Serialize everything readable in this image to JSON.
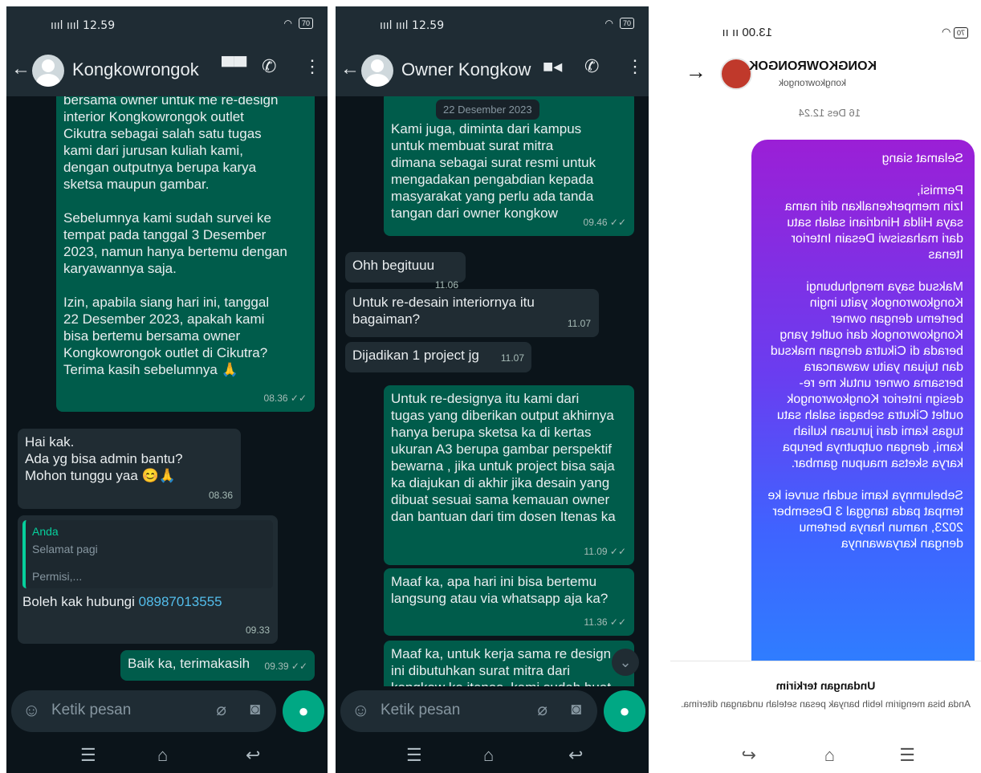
{
  "panel1": {
    "status_time": "12.59",
    "battery": "70",
    "chat_name": "Kongkowrongok",
    "messages": {
      "m1_text": "bersama owner untuk me re-design\ninterior Kongkowrongok outlet\nCikutra sebagai salah satu tugas\nkami dari jurusan kuliah kami,\ndengan outputnya berupa karya\nsketsa maupun gambar.\n\nSebelumnya kami sudah survei ke\ntempat pada tanggal 3 Desember\n2023, namun hanya bertemu dengan\nkaryawannya saja.\n\nIzin, apabila siang hari ini, tanggal\n22 Desember 2023, apakah kami\nbisa bertemu bersama owner\nKongkowrongok outlet di Cikutra?\nTerima kasih sebelumnya 🙏",
      "m1_time": "08.36",
      "m2_text": "Hai kak.\nAda yg bisa admin bantu?\nMohon tunggu yaa 😊🙏",
      "m2_time": "08.36",
      "m3_reply_sender": "Anda",
      "m3_reply_line1": "Selamat pagi",
      "m3_reply_line2": "Permisi,...",
      "m3_text": "Boleh kak hubungi ",
      "m3_phone": "08987013555",
      "m3_time": "09.33",
      "m4_text": "Baik ka, terimakasih",
      "m4_time": "09.39"
    },
    "composer_placeholder": "Ketik pesan"
  },
  "panel2": {
    "status_time": "12.59",
    "battery": "70",
    "chat_name": "Owner Kongkow",
    "date_pill": "22 Desember 2023",
    "messages": {
      "m1_text": "Kami juga, diminta dari kampus\nuntuk membuat surat mitra\ndimana sebagai surat resmi untuk\nmengadakan pengabdian kepada\nmasyarakat yang perlu ada tanda\ntangan dari owner kongkow",
      "m1_time": "09.46",
      "m2_text": "Ohh begituuu",
      "m2_time": "11.06",
      "m3_text": "Untuk re-desain interiornya itu\nbagaiman?",
      "m3_time": "11.07",
      "m4_text": "Dijadikan 1 project jg",
      "m4_time": "11.07",
      "m5_text": "Untuk re-designya itu kami dari\ntugas yang diberikan output akhirnya\nhanya berupa sketsa ka di kertas\nukuran A3 berupa gambar perspektif\nbewarna , jika untuk project bisa saja\nka diajukan di akhir jika desain yang\ndibuat sesuai sama kemauan owner\ndan bantuan dari tim dosen Itenas ka",
      "m5_time": "11.09",
      "m6_text": "Maaf ka, apa hari ini bisa bertemu\nlangsung atau via whatsapp aja ka?",
      "m6_time": "11.36",
      "m7_text": "Maaf ka, untuk kerja sama re design\nini dibutuhkan surat mitra dari\nkongkow ke itenas, kami sudah buat"
    },
    "composer_placeholder": "Ketik pesan"
  },
  "panel3": {
    "status_time": "13.00",
    "battery": "70",
    "account_name": "KONGKOWRONGOK",
    "account_username": "kongkowrongok",
    "date": "16 Des 12.24",
    "message_p1": "Selamat siang",
    "message_p2": "Permisi,\nIzin memperkenalkan diri nama saya Hilda Hindriani salah satu dari mahasiswi Desain Interior Itenas",
    "message_p3": "Maksud saya menghubungi Kongkowrongok yaitu ingin bertemu dengan owner Kongkowrongok dari outlet yang berada di Cikutra dengan maksud dan tujuan yaitu wawancara bersama owner untuk me re-design interior Kongkowrongok outlet Cikutra sebagai salah satu tugas kami dari jurusan kuliah kami, dengan outputnya berupa karya sketsa maupun gambar.",
    "message_p4": "Sebelumnya kami sudah survei ke tempat pada tanggal 3 Desember 2023, namun hanya bertemu dengan karyawannya",
    "invite_title": "Undangan terkirim",
    "invite_sub": "Anda bisa mengirim lebih banyak pesan setelah undangan diterima."
  }
}
